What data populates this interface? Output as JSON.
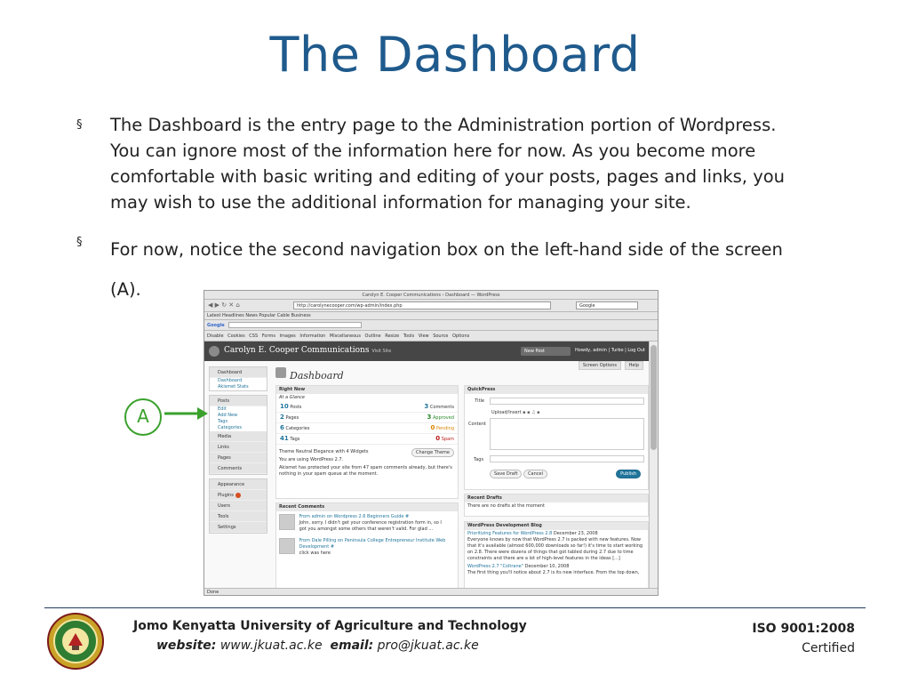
{
  "title": "The Dashboard",
  "bullets": [
    {
      "marker": "§",
      "text": "The Dashboard is the entry page to the Administration portion of Wordpress. You can ignore most of the information here for now. As you become more comfortable with basic writing and editing of your posts, pages and links, you may wish to use the additional information for managing your site."
    },
    {
      "marker": "§",
      "text": "For now, notice the second navigation box on the left-hand side of the screen (A)."
    }
  ],
  "callout": {
    "label": "A",
    "color": "#3aa12c"
  },
  "screenshot": {
    "window_title": "Carolyn E. Cooper Communications › Dashboard — WordPress",
    "url": "http://carolynecooper.com/wp-admin/index.php",
    "search_placeholder": "Google",
    "bookmarks": "Latest Headlines  News  Popular  Cable  Business",
    "google_label": "Google",
    "toolbar_items": "Disable  Cookies  CSS  Forms  Images  Information  Miscellaneous  Outline  Resize  Tools  View Source  Options",
    "site_name": "Carolyn E. Cooper Communications",
    "visit_site": "Visit Site",
    "new_post": "New Post",
    "howdy": "Howdy, admin | Turbo | Log Out",
    "screen_options": "Screen Options",
    "help": "Help",
    "page_heading": "Dashboard",
    "menu": {
      "dashboard": "Dashboard",
      "dashboard_sub": [
        "Dashboard",
        "Akismet Stats"
      ],
      "posts": "Posts",
      "posts_sub": [
        "Edit",
        "Add New",
        "Tags",
        "Categories"
      ],
      "media": "Media",
      "links": "Links",
      "pages": "Pages",
      "comments": "Comments",
      "appearance": "Appearance",
      "plugins": "Plugins",
      "users": "Users",
      "tools": "Tools",
      "settings": "Settings"
    },
    "right_now": {
      "header": "Right Now",
      "subheader": "At a Glance",
      "rows": [
        {
          "count": "10",
          "label": "Posts",
          "count2": "3",
          "label2": "Comments",
          "cls": ""
        },
        {
          "count": "2",
          "label": "Pages",
          "count2": "3",
          "label2": "Approved",
          "cls": "g"
        },
        {
          "count": "6",
          "label": "Categories",
          "count2": "0",
          "label2": "Pending",
          "cls": "o"
        },
        {
          "count": "41",
          "label": "Tags",
          "count2": "0",
          "label2": "Spam",
          "cls": "r"
        }
      ],
      "theme_line": "Theme Neutral Elegance with 4 Widgets",
      "change_theme": "Change Theme",
      "version_line": "You are using WordPress 2.7.",
      "akismet_line": "Akismet has protected your site from 47 spam comments already, but there's nothing in your spam queue at the moment."
    },
    "recent_comments": {
      "header": "Recent Comments",
      "c1_title": "From admin on Wordpress 2.6 Beginners Guide #",
      "c1_text": "John, sorry. I didn't get your conference registration form in, so I got you amongst some others that weren't valid. For glad ...",
      "c2_title": "From Dale Pilling on Peninsula College Entrepreneur Institute Web Development #",
      "c2_text": "click was here"
    },
    "quick_press": {
      "header": "QuickPress",
      "title_label": "Title",
      "upload_label": "Upload/Insert",
      "content_label": "Content",
      "tags_label": "Tags",
      "save_draft": "Save Draft",
      "cancel": "Cancel",
      "publish": "Publish"
    },
    "recent_drafts": {
      "header": "Recent Drafts",
      "text": "There are no drafts at the moment"
    },
    "dev_blog": {
      "header": "WordPress Development Blog",
      "p1_title": "Prioritizing Features for WordPress 2.8",
      "p1_date": "December 23, 2008",
      "p1_text": "Everyone knows by now that WordPress 2.7 is packed with new features. Now that it's available (almost 600,000 downloads so far!) it's time to start working on 2.8. There were dozens of things that got tabled during 2.7 due to time constraints and there are a lot of high-level features in the ideas [...]",
      "p2_title": "WordPress 2.7 \"Coltrane\"",
      "p2_date": "December 10, 2008",
      "p2_text": "The first thing you'll notice about 2.7 is its new interface. From the top down,"
    },
    "status": "Done"
  },
  "footer": {
    "university": "Jomo Kenyatta University of Agriculture and Technology",
    "website_label": "website:",
    "website": "www.jkuat.ac.ke",
    "email_label": "email:",
    "email": "pro@jkuat.ac.ke",
    "iso_line1": "ISO 9001:2008",
    "iso_line2": "Certified"
  }
}
